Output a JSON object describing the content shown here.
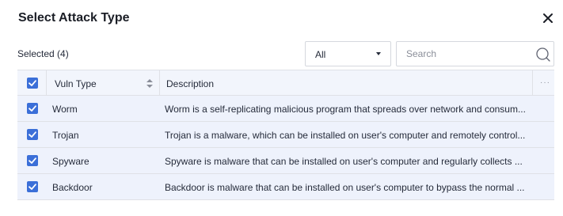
{
  "dialog": {
    "title": "Select Attack Type",
    "selected_label": "Selected (4)"
  },
  "filter": {
    "value": "All"
  },
  "search": {
    "placeholder": "Search",
    "value": ""
  },
  "table": {
    "columns": [
      "Vuln Type",
      "Description"
    ],
    "rows": [
      {
        "name": "Worm",
        "description": "Worm is a self-replicating malicious program that spreads over network and consum...",
        "checked": true
      },
      {
        "name": "Trojan",
        "description": "Trojan is a malware, which can be installed on user's computer and remotely control...",
        "checked": true
      },
      {
        "name": "Spyware",
        "description": "Spyware is malware that can be installed on user's computer and regularly collects ...",
        "checked": true
      },
      {
        "name": "Backdoor",
        "description": "Backdoor is malware that can be installed on user's computer to bypass the normal ...",
        "checked": true
      }
    ]
  },
  "colors": {
    "accent": "#3b6fd8",
    "header_bg": "#f2f5fc",
    "selected_row_bg": "#eef2fc"
  },
  "icons": [
    "close-icon",
    "chevron-down-icon",
    "search-icon",
    "sort-icon",
    "more-icon",
    "checkbox-checked-icon"
  ]
}
